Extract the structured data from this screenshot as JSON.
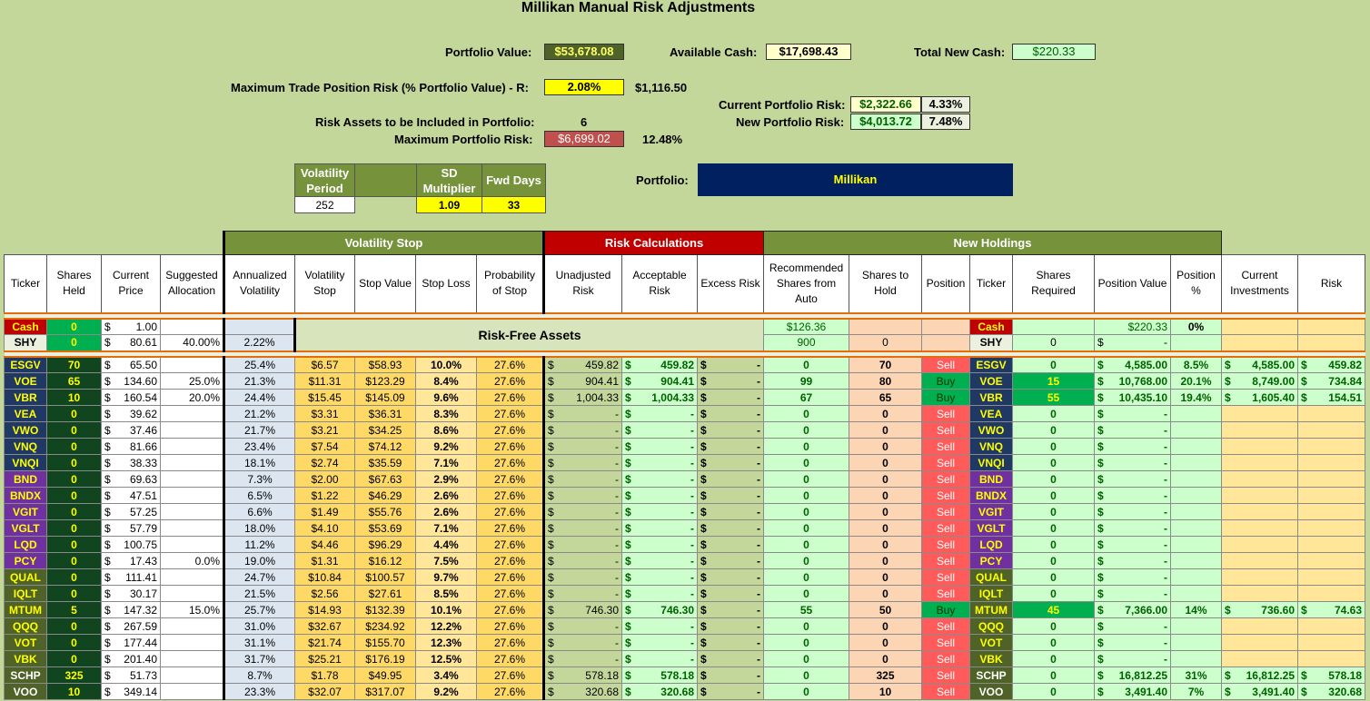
{
  "title": "Millikan Manual Risk Adjustments",
  "portfolio_value": {
    "label": "Portfolio Value:",
    "value": "$53,678.08"
  },
  "available_cash": {
    "label": "Available Cash:",
    "value": "$17,698.43"
  },
  "total_new_cash": {
    "label": "Total New Cash:",
    "value": "$220.33"
  },
  "max_trade_risk": {
    "label": "Maximum Trade Position Risk (% Portfolio Value) - R:",
    "pct": "2.08%",
    "amount": "$1,116.50"
  },
  "current_portfolio_risk": {
    "label": "Current Portfolio Risk:",
    "amount": "$2,322.66",
    "pct": "4.33%"
  },
  "new_portfolio_risk": {
    "label": "New Portfolio Risk:",
    "amount": "$4,013.72",
    "pct": "7.48%"
  },
  "risk_assets": {
    "label": "Risk Assets to be Included in Portfolio:",
    "value": "6"
  },
  "max_portfolio_risk": {
    "label": "Maximum Portfolio Risk:",
    "amount": "$6,699.02",
    "pct": "12.48%"
  },
  "vol_params": {
    "h1": "Volatility Period",
    "h2": "SD Multiplier",
    "h3": "Fwd Days",
    "v1": "252",
    "v2": "1.09",
    "v3": "33"
  },
  "portfolio_name": {
    "label": "Portfolio:",
    "value": "Millikan"
  },
  "groups": {
    "volatility_stop": "Volatility Stop",
    "risk_calculations": "Risk Calculations",
    "new_holdings": "New Holdings"
  },
  "headers": [
    "Ticker",
    "Shares Held",
    "Current Price",
    "Suggested Allocation",
    "Annualized Volatility",
    "Volatility Stop",
    "Stop Value",
    "Stop Loss",
    "Probability of Stop",
    "Unadjusted Risk",
    "Acceptable Risk",
    "Excess Risk",
    "Recommended Shares from Auto",
    "Shares to Hold",
    "Position",
    "Ticker",
    "Shares Required",
    "Position Value",
    "Position %",
    "Current Investments",
    "Risk"
  ],
  "risk_free_label": "Risk-Free Assets",
  "cash_row": {
    "ticker": "Cash",
    "shares": "0",
    "price": "1.00",
    "rec": "$126.36",
    "ticker2": "Cash",
    "posval": "$220.33",
    "pct": "0%"
  },
  "shy_row": {
    "ticker": "SHY",
    "shares": "0",
    "price": "80.61",
    "alloc": "40.00%",
    "vol": "2.22%",
    "rec": "900",
    "hold": "0",
    "ticker2": "SHY",
    "req": "0",
    "posval": "-"
  },
  "rows": [
    {
      "t": "ESGV",
      "s": "70",
      "p": "65.50",
      "a": "",
      "v": "25.4%",
      "vs": "$6.57",
      "sv": "$58.93",
      "sl": "10.0%",
      "ps": "27.6%",
      "ur": "459.82",
      "ar": "459.82",
      "ex": "-",
      "rec": "0",
      "hold": "70",
      "pos": "Sell",
      "req": "0",
      "pv": "4,585.00",
      "pp": "8.5%",
      "ci": "4,585.00",
      "rk": "459.82"
    },
    {
      "t": "VOE",
      "s": "65",
      "p": "134.60",
      "a": "25.0%",
      "v": "21.3%",
      "vs": "$11.31",
      "sv": "$123.29",
      "sl": "8.4%",
      "ps": "27.6%",
      "ur": "904.41",
      "ar": "904.41",
      "ex": "-",
      "rec": "99",
      "hold": "80",
      "pos": "Buy",
      "req": "15",
      "pv": "10,768.00",
      "pp": "20.1%",
      "ci": "8,749.00",
      "rk": "734.84"
    },
    {
      "t": "VBR",
      "s": "10",
      "p": "160.54",
      "a": "20.0%",
      "v": "24.4%",
      "vs": "$15.45",
      "sv": "$145.09",
      "sl": "9.6%",
      "ps": "27.6%",
      "ur": "1,004.33",
      "ar": "1,004.33",
      "ex": "-",
      "rec": "67",
      "hold": "65",
      "pos": "Buy",
      "req": "55",
      "pv": "10,435.10",
      "pp": "19.4%",
      "ci": "1,605.40",
      "rk": "154.51"
    },
    {
      "t": "VEA",
      "s": "0",
      "p": "39.62",
      "a": "",
      "v": "21.2%",
      "vs": "$3.31",
      "sv": "$36.31",
      "sl": "8.3%",
      "ps": "27.6%",
      "ur": "-",
      "ar": "-",
      "ex": "-",
      "rec": "0",
      "hold": "0",
      "pos": "Sell",
      "req": "0",
      "pv": "-",
      "pp": "",
      "ci": "",
      "rk": ""
    },
    {
      "t": "VWO",
      "s": "0",
      "p": "37.46",
      "a": "",
      "v": "21.7%",
      "vs": "$3.21",
      "sv": "$34.25",
      "sl": "8.6%",
      "ps": "27.6%",
      "ur": "-",
      "ar": "-",
      "ex": "-",
      "rec": "0",
      "hold": "0",
      "pos": "Sell",
      "req": "0",
      "pv": "-",
      "pp": "",
      "ci": "",
      "rk": ""
    },
    {
      "t": "VNQ",
      "s": "0",
      "p": "81.66",
      "a": "",
      "v": "23.4%",
      "vs": "$7.54",
      "sv": "$74.12",
      "sl": "9.2%",
      "ps": "27.6%",
      "ur": "-",
      "ar": "-",
      "ex": "-",
      "rec": "0",
      "hold": "0",
      "pos": "Sell",
      "req": "0",
      "pv": "-",
      "pp": "",
      "ci": "",
      "rk": ""
    },
    {
      "t": "VNQI",
      "s": "0",
      "p": "38.33",
      "a": "",
      "v": "18.1%",
      "vs": "$2.74",
      "sv": "$35.59",
      "sl": "7.1%",
      "ps": "27.6%",
      "ur": "-",
      "ar": "-",
      "ex": "-",
      "rec": "0",
      "hold": "0",
      "pos": "Sell",
      "req": "0",
      "pv": "-",
      "pp": "",
      "ci": "",
      "rk": ""
    },
    {
      "t": "BND",
      "s": "0",
      "p": "69.63",
      "a": "",
      "v": "7.3%",
      "vs": "$2.00",
      "sv": "$67.63",
      "sl": "2.9%",
      "ps": "27.6%",
      "ur": "-",
      "ar": "-",
      "ex": "-",
      "rec": "0",
      "hold": "0",
      "pos": "Sell",
      "req": "0",
      "pv": "-",
      "pp": "",
      "ci": "",
      "rk": ""
    },
    {
      "t": "BNDX",
      "s": "0",
      "p": "47.51",
      "a": "",
      "v": "6.5%",
      "vs": "$1.22",
      "sv": "$46.29",
      "sl": "2.6%",
      "ps": "27.6%",
      "ur": "-",
      "ar": "-",
      "ex": "-",
      "rec": "0",
      "hold": "0",
      "pos": "Sell",
      "req": "0",
      "pv": "-",
      "pp": "",
      "ci": "",
      "rk": ""
    },
    {
      "t": "VGIT",
      "s": "0",
      "p": "57.25",
      "a": "",
      "v": "6.6%",
      "vs": "$1.49",
      "sv": "$55.76",
      "sl": "2.6%",
      "ps": "27.6%",
      "ur": "-",
      "ar": "-",
      "ex": "-",
      "rec": "0",
      "hold": "0",
      "pos": "Sell",
      "req": "0",
      "pv": "-",
      "pp": "",
      "ci": "",
      "rk": ""
    },
    {
      "t": "VGLT",
      "s": "0",
      "p": "57.79",
      "a": "",
      "v": "18.0%",
      "vs": "$4.10",
      "sv": "$53.69",
      "sl": "7.1%",
      "ps": "27.6%",
      "ur": "-",
      "ar": "-",
      "ex": "-",
      "rec": "0",
      "hold": "0",
      "pos": "Sell",
      "req": "0",
      "pv": "-",
      "pp": "",
      "ci": "",
      "rk": ""
    },
    {
      "t": "LQD",
      "s": "0",
      "p": "100.75",
      "a": "",
      "v": "11.2%",
      "vs": "$4.46",
      "sv": "$96.29",
      "sl": "4.4%",
      "ps": "27.6%",
      "ur": "-",
      "ar": "-",
      "ex": "-",
      "rec": "0",
      "hold": "0",
      "pos": "Sell",
      "req": "0",
      "pv": "-",
      "pp": "",
      "ci": "",
      "rk": ""
    },
    {
      "t": "PCY",
      "s": "0",
      "p": "17.43",
      "a": "0.0%",
      "v": "19.0%",
      "vs": "$1.31",
      "sv": "$16.12",
      "sl": "7.5%",
      "ps": "27.6%",
      "ur": "-",
      "ar": "-",
      "ex": "-",
      "rec": "0",
      "hold": "0",
      "pos": "Sell",
      "req": "0",
      "pv": "-",
      "pp": "",
      "ci": "",
      "rk": ""
    },
    {
      "t": "QUAL",
      "s": "0",
      "p": "111.41",
      "a": "",
      "v": "24.7%",
      "vs": "$10.84",
      "sv": "$100.57",
      "sl": "9.7%",
      "ps": "27.6%",
      "ur": "-",
      "ar": "-",
      "ex": "-",
      "rec": "0",
      "hold": "0",
      "pos": "Sell",
      "req": "0",
      "pv": "-",
      "pp": "",
      "ci": "",
      "rk": ""
    },
    {
      "t": "IQLT",
      "s": "0",
      "p": "30.17",
      "a": "",
      "v": "21.5%",
      "vs": "$2.56",
      "sv": "$27.61",
      "sl": "8.5%",
      "ps": "27.6%",
      "ur": "-",
      "ar": "-",
      "ex": "-",
      "rec": "0",
      "hold": "0",
      "pos": "Sell",
      "req": "0",
      "pv": "-",
      "pp": "",
      "ci": "",
      "rk": ""
    },
    {
      "t": "MTUM",
      "s": "5",
      "p": "147.32",
      "a": "15.0%",
      "v": "25.7%",
      "vs": "$14.93",
      "sv": "$132.39",
      "sl": "10.1%",
      "ps": "27.6%",
      "ur": "746.30",
      "ar": "746.30",
      "ex": "-",
      "rec": "55",
      "hold": "50",
      "pos": "Buy",
      "req": "45",
      "pv": "7,366.00",
      "pp": "14%",
      "ci": "736.60",
      "rk": "74.63"
    },
    {
      "t": "QQQ",
      "s": "0",
      "p": "267.59",
      "a": "",
      "v": "31.0%",
      "vs": "$32.67",
      "sv": "$234.92",
      "sl": "12.2%",
      "ps": "27.6%",
      "ur": "-",
      "ar": "-",
      "ex": "-",
      "rec": "0",
      "hold": "0",
      "pos": "Sell",
      "req": "0",
      "pv": "-",
      "pp": "",
      "ci": "",
      "rk": ""
    },
    {
      "t": "VOT",
      "s": "0",
      "p": "177.44",
      "a": "",
      "v": "31.1%",
      "vs": "$21.74",
      "sv": "$155.70",
      "sl": "12.3%",
      "ps": "27.6%",
      "ur": "-",
      "ar": "-",
      "ex": "-",
      "rec": "0",
      "hold": "0",
      "pos": "Sell",
      "req": "0",
      "pv": "-",
      "pp": "",
      "ci": "",
      "rk": ""
    },
    {
      "t": "VBK",
      "s": "0",
      "p": "201.40",
      "a": "",
      "v": "31.7%",
      "vs": "$25.21",
      "sv": "$176.19",
      "sl": "12.5%",
      "ps": "27.6%",
      "ur": "-",
      "ar": "-",
      "ex": "-",
      "rec": "0",
      "hold": "0",
      "pos": "Sell",
      "req": "0",
      "pv": "-",
      "pp": "",
      "ci": "",
      "rk": ""
    },
    {
      "t": "SCHP",
      "s": "325",
      "p": "51.73",
      "a": "",
      "v": "8.7%",
      "vs": "$1.78",
      "sv": "$49.95",
      "sl": "3.4%",
      "ps": "27.6%",
      "ur": "578.18",
      "ar": "578.18",
      "ex": "-",
      "rec": "0",
      "hold": "325",
      "pos": "Sell",
      "req": "0",
      "pv": "16,812.25",
      "pp": "31%",
      "ci": "16,812.25",
      "rk": "578.18"
    },
    {
      "t": "VOO",
      "s": "10",
      "p": "349.14",
      "a": "",
      "v": "23.3%",
      "vs": "$32.07",
      "sv": "$317.07",
      "sl": "9.2%",
      "ps": "27.6%",
      "ur": "320.68",
      "ar": "320.68",
      "ex": "-",
      "rec": "0",
      "hold": "10",
      "pos": "Sell",
      "req": "0",
      "pv": "3,491.40",
      "pp": "7%",
      "ci": "3,491.40",
      "rk": "320.68"
    }
  ],
  "colors": {
    "background": "#c4d79b",
    "header_olive": "#76933c",
    "risk_red": "#c00000",
    "navy": "#002060",
    "yellow": "#ffff00",
    "buy_green": "#00b050",
    "sell_red": "#ff5b5b",
    "ticker_navy": "#1f3864",
    "ticker_purple": "#7030a0",
    "ticker_olive": "#4f6228"
  }
}
